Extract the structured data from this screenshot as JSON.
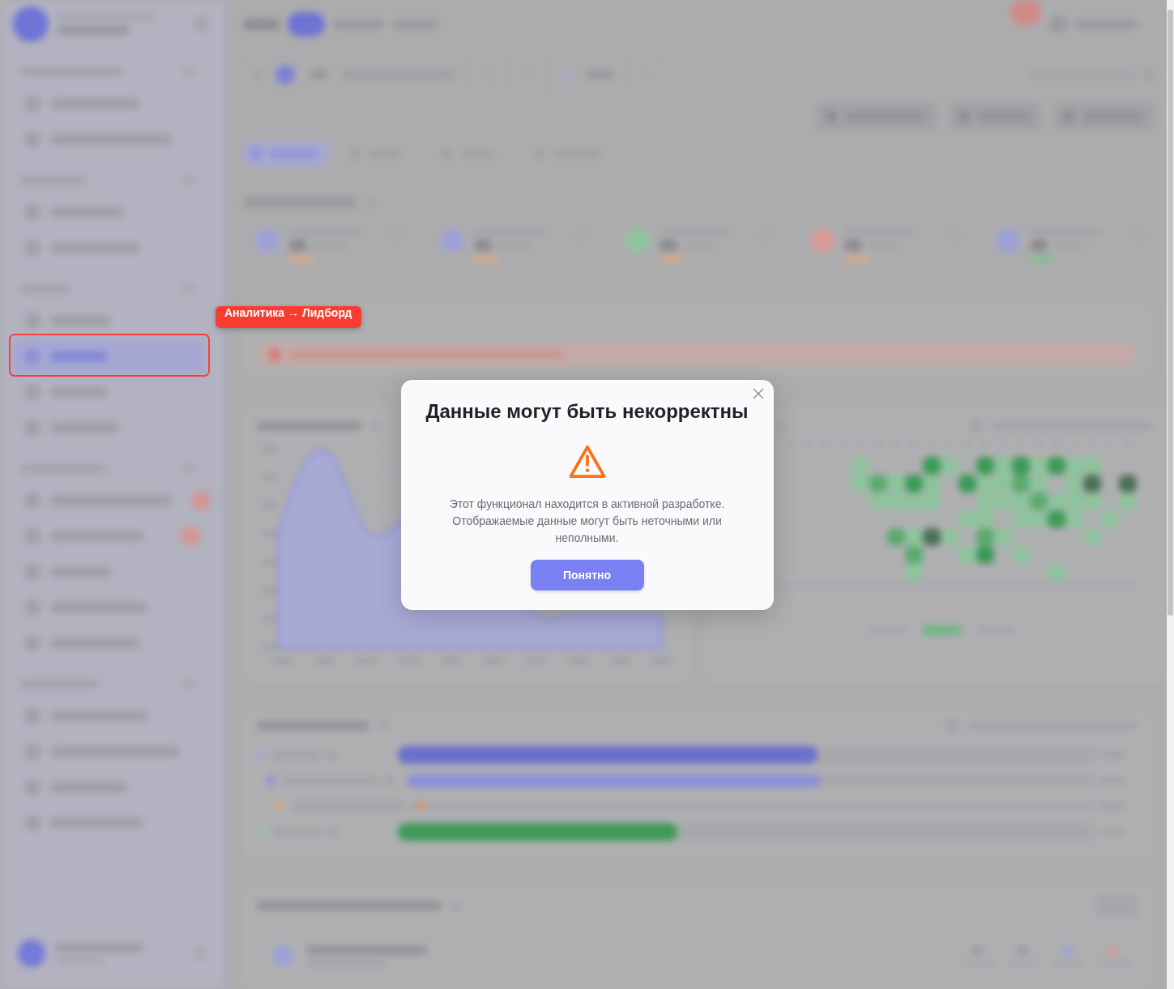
{
  "annotation": {
    "label": "Аналитика → Лидборд"
  },
  "dialog": {
    "title": "Данные могут быть некорректны",
    "message": "Этот функционал находится в активной разработке. Отображаемые данные могут быть неточными или неполными.",
    "button": "Понятно"
  }
}
